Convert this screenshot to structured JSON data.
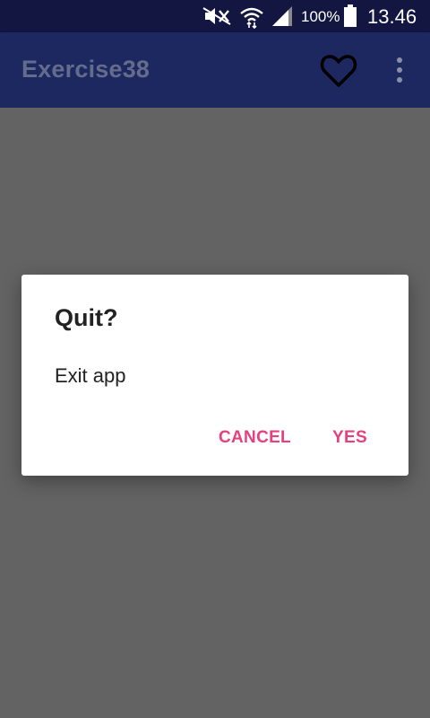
{
  "status_bar": {
    "battery_percent": "100%",
    "time": "13.46",
    "icons": [
      "mute-icon",
      "wifi-icon",
      "signal-icon",
      "battery-icon"
    ]
  },
  "app_bar": {
    "title": "Exercise38",
    "actions": [
      "heart-icon",
      "more-vert-icon"
    ]
  },
  "dialog": {
    "title": "Quit?",
    "message": "Exit app",
    "cancel_label": "CANCEL",
    "confirm_label": "YES"
  },
  "colors": {
    "status_bar": "#121640",
    "app_bar": "#1e2860",
    "scrim": "#636363",
    "accent": "#e6407e"
  }
}
